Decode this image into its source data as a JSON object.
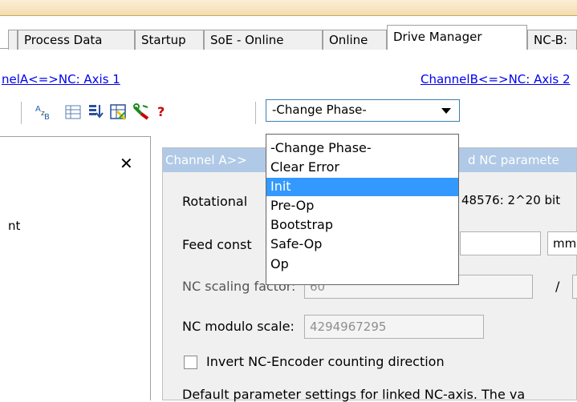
{
  "tabs": [
    {
      "label": "Process Data"
    },
    {
      "label": "Startup"
    },
    {
      "label": "SoE - Online"
    },
    {
      "label": "Online"
    },
    {
      "label": "Drive Manager"
    },
    {
      "label": "NC-B:"
    }
  ],
  "channel_links": {
    "a": "nelA<=>NC: Axis 1",
    "b": "ChannelB<=>NC: Axis 2"
  },
  "toolbar": {
    "help_glyph": "?",
    "combo_value": "-Change Phase-",
    "icons": [
      "az-sort-icon",
      "list-view-icon",
      "download-icon",
      "table-tool-icon",
      "wrench-icon",
      "help-icon"
    ]
  },
  "left_panel": {
    "close_glyph": "✕",
    "item_text": "nt"
  },
  "dialog": {
    "title_left": "Channel A>>",
    "title_right": "d NC paramete",
    "rotational_label": "Rotational",
    "rotational_value": "48576: 2^20 bit",
    "feed_label": "Feed const",
    "feed_unit": "mm",
    "nc_scaling_label": "NC scaling factor:",
    "nc_scaling_value": "60",
    "slash": "/",
    "nc_modulo_label": "NC modulo scale:",
    "nc_modulo_value": "4294967295",
    "invert_label": "Invert NC-Encoder counting direction",
    "default_text": "Default parameter settings for linked NC-axis. The va"
  },
  "dropdown": {
    "selected": "Init",
    "options": [
      "-Change Phase-",
      "Clear Error",
      "Init",
      "Pre-Op",
      "Bootstrap",
      "Safe-Op",
      "Op"
    ]
  },
  "colors": {
    "accent": "#3399ff",
    "link": "#0000ee",
    "title_bar": "#b0c9e6"
  }
}
